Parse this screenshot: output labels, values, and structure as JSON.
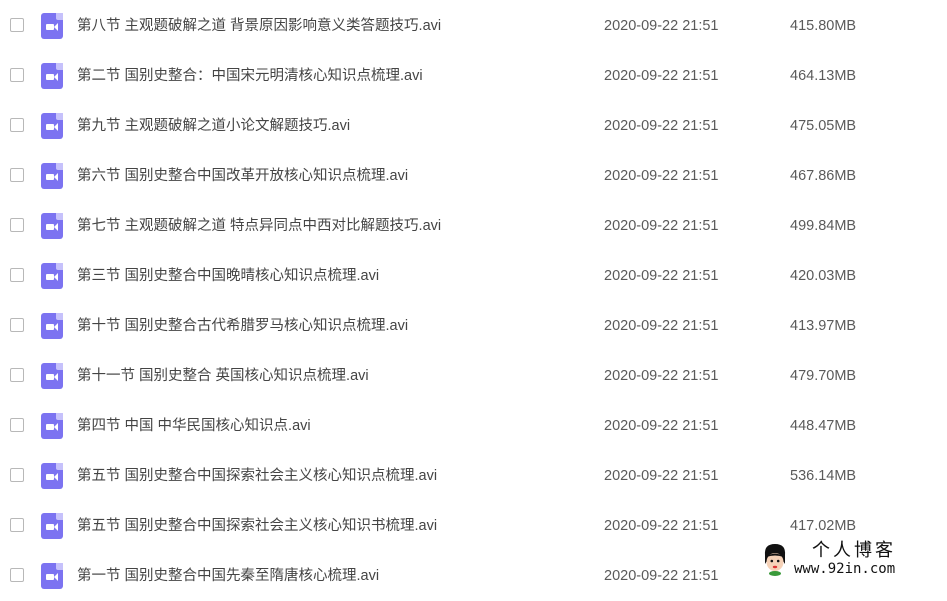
{
  "files": [
    {
      "name": "第八节 主观题破解之道 背景原因影响意义类答题技巧.avi",
      "modified": "2020-09-22 21:51",
      "size": "415.80MB"
    },
    {
      "name": "第二节 国别史整合：中国宋元明清核心知识点梳理.avi",
      "modified": "2020-09-22 21:51",
      "size": "464.13MB"
    },
    {
      "name": "第九节 主观题破解之道小论文解题技巧.avi",
      "modified": "2020-09-22 21:51",
      "size": "475.05MB"
    },
    {
      "name": "第六节 国别史整合中国改革开放核心知识点梳理.avi",
      "modified": "2020-09-22 21:51",
      "size": "467.86MB"
    },
    {
      "name": "第七节 主观题破解之道 特点异同点中西对比解题技巧.avi",
      "modified": "2020-09-22 21:51",
      "size": "499.84MB"
    },
    {
      "name": "第三节 国别史整合中国晚晴核心知识点梳理.avi",
      "modified": "2020-09-22 21:51",
      "size": "420.03MB"
    },
    {
      "name": "第十节 国别史整合古代希腊罗马核心知识点梳理.avi",
      "modified": "2020-09-22 21:51",
      "size": "413.97MB"
    },
    {
      "name": "第十一节 国别史整合 英国核心知识点梳理.avi",
      "modified": "2020-09-22 21:51",
      "size": "479.70MB"
    },
    {
      "name": "第四节 中国 中华民国核心知识点.avi",
      "modified": "2020-09-22 21:51",
      "size": "448.47MB"
    },
    {
      "name": "第五节 国别史整合中国探索社会主义核心知识点梳理.avi",
      "modified": "2020-09-22 21:51",
      "size": "536.14MB"
    },
    {
      "name": "第五节 国别史整合中国探索社会主义核心知识书梳理.avi",
      "modified": "2020-09-22 21:51",
      "size": "417.02MB"
    },
    {
      "name": "第一节 国别史整合中国先秦至隋唐核心梳理.avi",
      "modified": "2020-09-22 21:51",
      "size": ""
    }
  ],
  "file_icon": "video-file-icon",
  "colors": {
    "file_icon": "#7c73f1",
    "text": "#444444",
    "meta_text": "#5a5a5a",
    "checkbox_border": "#b8b8b8"
  },
  "watermark": {
    "title": "个人博客",
    "url": "www.92in.com"
  }
}
